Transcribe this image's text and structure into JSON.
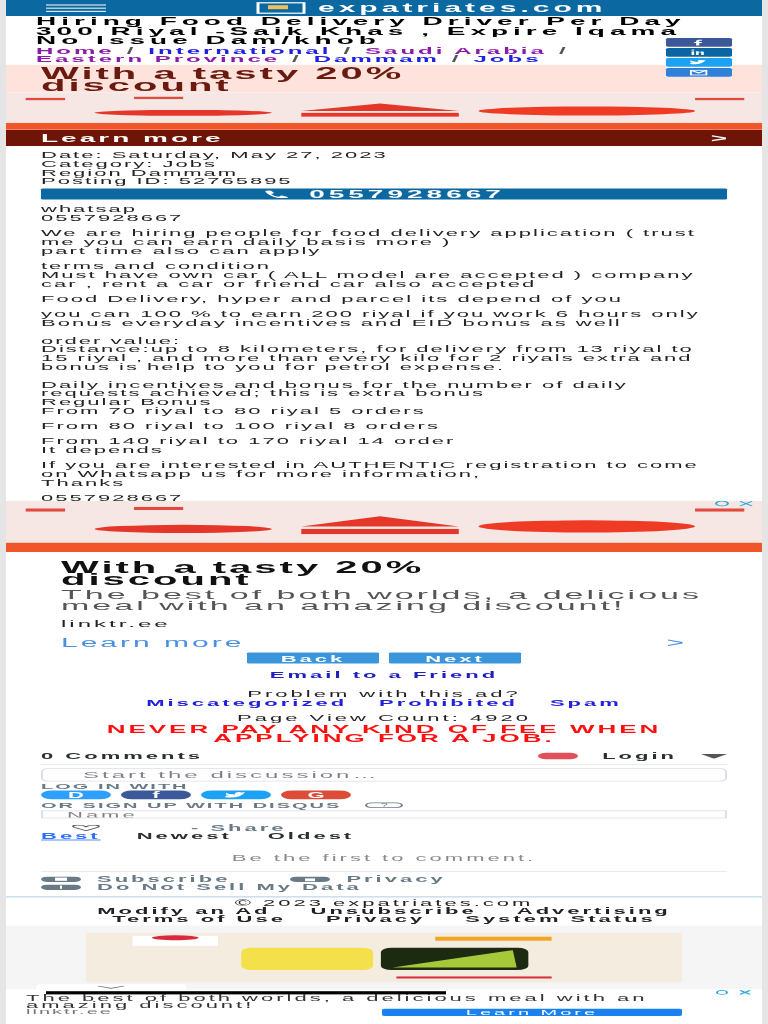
{
  "header": {
    "site": "expatriates.com"
  },
  "title": "Hiring Food Delivery Driver Per Day 300 Riyal -Saik Khas , Expire Iqama No Issue Dam/khob",
  "breadcrumbs": [
    {
      "label": "Home",
      "visited": true
    },
    {
      "separator": "/",
      "label": "International",
      "visited": false
    },
    {
      "separator": "/",
      "label": "Saudi Arabia",
      "visited": true
    },
    {
      "separator": "/",
      "label": "Eastern Province",
      "visited": true
    },
    {
      "separator": "/",
      "label": "Dammam",
      "visited": false
    },
    {
      "separator": "/",
      "label": "Jobs",
      "visited": false
    }
  ],
  "share_buttons": [
    {
      "kind": "facebook"
    },
    {
      "kind": "linkedin"
    },
    {
      "kind": "twitter"
    },
    {
      "kind": "email"
    }
  ],
  "top_ad": {
    "headline": "With a tasty 20% discount",
    "cta": "Learn more",
    "chevron": ">"
  },
  "details": [
    "Date: Saturday, May 27, 2023",
    "Category: Jobs",
    "Region Dammam",
    "Posting ID: 52765895"
  ],
  "phone_button": "0557928667",
  "body": [
    "whatsap\n0557928667",
    "We are hiring people for food delivery application ( trust me you can earn daily basis more )\npart time also can apply",
    "terms and condition\nMust have own car ( ALL model are accepted ) company car , rent a car or friend car also accepted",
    "Food Delivery, hyper and parcel its depend of you",
    "you can 100 % to earn 200 riyal if you work 6 hours only\nBonus everyday incentives and EID bonus as well",
    "order value:\nDistance:up to 8 kilometers, for delivery from 13 riyal to 15 riyal , and more than every kilo for 2 riyals extra and bonus is help to you for petrol expense.",
    "Daily incentives and bonus for the number of daily requests achieved; this is extra bonus\nRegular Bonus\nFrom 70 riyal to 80 riyal 5 orders",
    "From 80 riyal to 100 riyal 8 orders",
    "From 140 riyal to 170 riyal 14 order\nIt depends",
    "If you are interested in AUTHENTIC registration to come on Whatsapp us for more information,\nThanks",
    "0557928667"
  ],
  "mid_ad": {
    "headline": "With a tasty 20% discount",
    "description": "The best of both worlds, a delicious meal with an amazing discount!",
    "domain": "linktr.ee",
    "cta": "Learn more",
    "chevron": ">"
  },
  "nav_buttons": [
    "Back",
    "Next"
  ],
  "email_link": "Email to a Friend",
  "problem": {
    "question": "Problem with this ad?",
    "links": [
      "Miscategorized",
      "Prohibited",
      "Spam"
    ]
  },
  "page_views": "Page View Count: 4920",
  "warning": "NEVER PAY ANY KIND OF FEE WHEN APPLYING FOR A JOB.",
  "comments": {
    "count": "0 Comments",
    "login": "Login",
    "placeholder": "Start the discussion…",
    "login_with": "LOG IN WITH",
    "social": [
      {
        "kind": "disqus",
        "glyph": "D",
        "color": "#2e9fff"
      },
      {
        "kind": "facebook",
        "glyph": "f",
        "color": "#3b5998"
      },
      {
        "kind": "twitter",
        "color": "#1da1f2"
      },
      {
        "kind": "google",
        "glyph": "G",
        "color": "#dd4b39"
      }
    ],
    "signup": "OR SIGN UP WITH DISQUS",
    "help": "?",
    "name_placeholder": "Name",
    "share": "- Share",
    "sort": [
      {
        "label": "Best",
        "selected": true
      },
      {
        "label": "Newest",
        "selected": false
      },
      {
        "label": "Oldest",
        "selected": false
      }
    ],
    "empty": "Be the first to comment.",
    "footer_links": [
      {
        "kind": "mail",
        "label": "Subscribe"
      },
      {
        "kind": "lock",
        "label": "Privacy"
      },
      {
        "kind": "alert",
        "label": "Do Not Sell My Data"
      }
    ]
  },
  "footer": {
    "copyright": "© 2023 expatriates.com",
    "links": [
      "Modify an Ad",
      "Unsubscribe",
      "Advertising",
      "Terms of Use",
      "Privacy",
      "System Status"
    ]
  },
  "bottom_ad": {
    "description": "The best of both worlds, a delicious meal with an amazing discount!",
    "domain": "linktr.ee",
    "cta": "Learn More"
  }
}
